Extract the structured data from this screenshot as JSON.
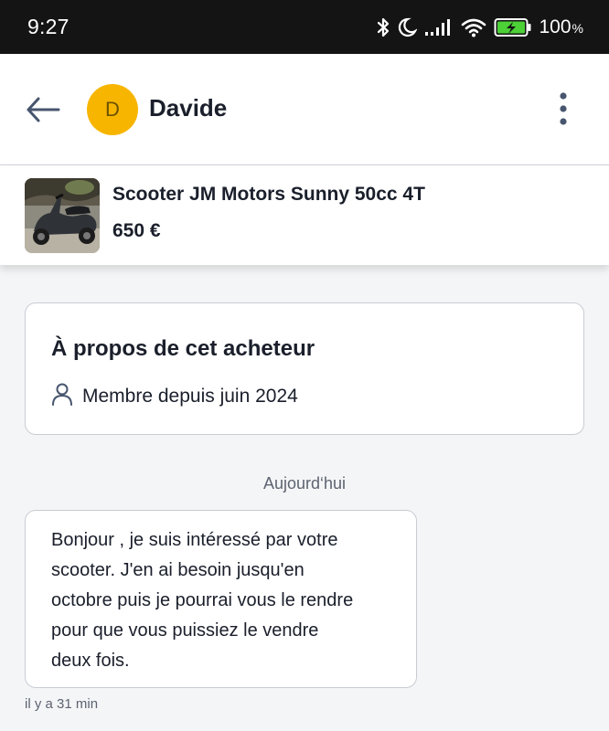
{
  "status_bar": {
    "time": "9:27",
    "battery_percent": "100",
    "battery_percent_sign": "%",
    "icons": [
      "bluetooth-icon",
      "moon-icon",
      "signal-icon",
      "wifi-icon",
      "battery-charging-icon"
    ]
  },
  "header": {
    "back_icon": "arrow-left-icon",
    "avatar_initial": "D",
    "avatar_color": "#f7b500",
    "contact_name": "Davide",
    "menu_icon": "more-vertical-icon"
  },
  "product": {
    "title": "Scooter JM Motors Sunny 50cc 4T",
    "price": "650 €"
  },
  "about": {
    "title": "À propos de cet acheteur",
    "icon": "user-icon",
    "member_since": "Membre depuis juin 2024"
  },
  "conversation": {
    "date_label": "Aujourd‘hui",
    "messages": [
      {
        "lines": [
          "Bonjour , je suis intéressé par votre",
          "scooter. J'en ai besoin jusqu'en",
          "octobre puis je pourrai vous le rendre",
          "pour que vous puissiez le vendre",
          "deux fois."
        ],
        "time": "il y a 31 min"
      }
    ]
  }
}
